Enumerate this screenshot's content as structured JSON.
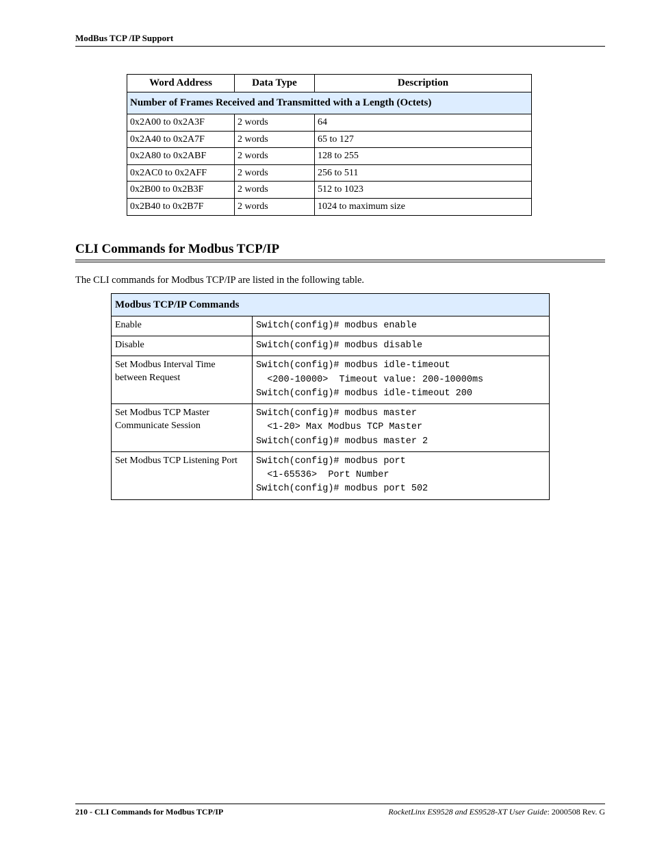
{
  "header_title": "ModBus TCP /IP Support",
  "table1": {
    "headers": {
      "c1": "Word Address",
      "c2": "Data Type",
      "c3": "Description"
    },
    "subheader": "Number of Frames Received and Transmitted with a Length (Octets)",
    "rows": [
      {
        "addr": "0x2A00 to 0x2A3F",
        "type": "2 words",
        "desc": "64"
      },
      {
        "addr": "0x2A40 to 0x2A7F",
        "type": "2 words",
        "desc": "65 to 127"
      },
      {
        "addr": "0x2A80 to 0x2ABF",
        "type": "2 words",
        "desc": "128 to 255"
      },
      {
        "addr": "0x2AC0 to 0x2AFF",
        "type": "2 words",
        "desc": "256 to 511"
      },
      {
        "addr": "0x2B00 to 0x2B3F",
        "type": "2 words",
        "desc": "512 to 1023"
      },
      {
        "addr": "0x2B40 to 0x2B7F",
        "type": "2 words",
        "desc": "1024 to maximum size"
      }
    ]
  },
  "section_title": "CLI Commands for Modbus TCP/IP",
  "intro_text": "The CLI commands for Modbus TCP/IP are listed in the following table.",
  "table2": {
    "header": "Modbus TCP/IP Commands",
    "rows": [
      {
        "name": "Enable",
        "cmd": "Switch(config)# modbus enable"
      },
      {
        "name": "Disable",
        "cmd": "Switch(config)# modbus disable"
      },
      {
        "name": "Set Modbus Interval Time between Request",
        "cmd": "Switch(config)# modbus idle-timeout\n  <200-10000>  Timeout value: 200-10000ms\nSwitch(config)# modbus idle-timeout 200"
      },
      {
        "name": "Set Modbus TCP Master Communicate Session",
        "cmd": "Switch(config)# modbus master\n  <1-20> Max Modbus TCP Master\nSwitch(config)# modbus master 2"
      },
      {
        "name": "Set Modbus TCP Listening Port",
        "cmd": "Switch(config)# modbus port\n  <1-65536>  Port Number\nSwitch(config)# modbus port 502"
      }
    ]
  },
  "footer": {
    "page_num": "210",
    "left_title": "CLI Commands for Modbus TCP/IP",
    "right_title": "RocketLinx ES9528 and ES9528-XT User Guide",
    "doc_rev": ": 2000508 Rev. G"
  }
}
